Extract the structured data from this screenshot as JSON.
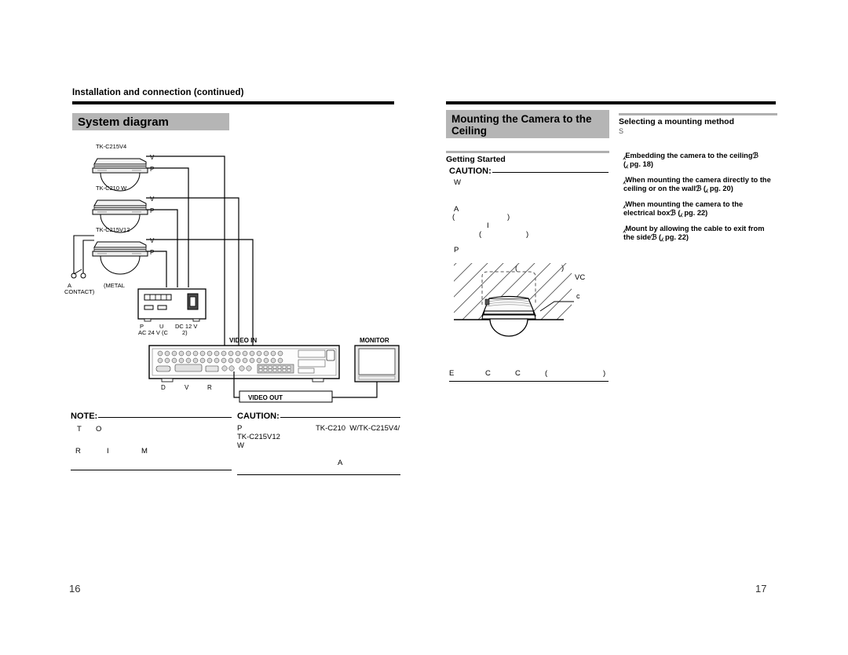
{
  "document": {
    "running_head": "Installation and connection (continued)",
    "left_page_number": "16",
    "right_page_number": "17"
  },
  "left_page": {
    "section_title": "System diagram",
    "diagram": {
      "camera_labels": [
        "TK-C215V4",
        "TK-C210  W",
        "TK-C215V12"
      ],
      "port_labels": [
        "V",
        "P"
      ],
      "contact_label_line1": "A",
      "contact_label_line2": "CONTACT)",
      "metal_label": "(METAL",
      "power_supply": {
        "line1_a": "P",
        "line1_b": "U",
        "line1_c": "DC 12 V",
        "line2_a": "AC 24 V (C",
        "line2_b": "2)"
      },
      "video_in_label": "VIDEO IN",
      "video_out_label": "VIDEO OUT",
      "monitor_label": "MONITOR",
      "dvr_caption": [
        "D",
        "V",
        "R"
      ]
    },
    "note_block": {
      "heading": "NOTE:",
      "frag_1": "T",
      "frag_2": "O",
      "frag_3": "R",
      "frag_4": "I",
      "frag_5": "M"
    },
    "caution_block": {
      "heading": "CAUTION:",
      "frag_1": "P",
      "frag_2": "TK-C210  W/TK-C215V4/",
      "frag_3": "TK-C215V12",
      "frag_4": "W",
      "frag_5": "A"
    }
  },
  "right_page": {
    "section_title_line1": "Mounting the Camera to the",
    "section_title_line2": "Ceiling",
    "getting_started": {
      "heading": "Getting Started",
      "caution_heading": "CAUTION:",
      "frag_1": "W",
      "frag_2": "A",
      "frag_3": "(",
      "frag_4": ")",
      "frag_5": "I",
      "frag_6": "(",
      "frag_7": ")",
      "frag_8": "P",
      "frag_9": "(",
      "frag_10": ")",
      "frag_11": "VC"
    },
    "ceiling_figure": {
      "callout": "c",
      "caption_1": "E",
      "caption_2": "C",
      "caption_3": "C",
      "caption_4": "(",
      "caption_5": ")"
    },
    "selecting_method": {
      "heading": "Selecting a mounting method",
      "sub_fragment": "S",
      "items": [
        {
          "text_line1": "⁁Embedding the camera to the ceilingℬ",
          "text_line2": "(⁁  pg. 18)"
        },
        {
          "text_line1": "⁁When mounting the camera directly to the",
          "text_line2": "ceiling or on the wallℬ (⁁   pg. 20)"
        },
        {
          "text_line1": "⁁When mounting the camera to the",
          "text_line2": "electrical boxℬ (⁁  pg. 22)"
        },
        {
          "text_line1": "⁁Mount by allowing the cable to exit from",
          "text_line2": "the sideℬ (⁁  pg. 22)"
        }
      ]
    }
  },
  "colors": {
    "band_gray": "#b5b5b5",
    "rule_black": "#000000",
    "subbar_gray": "#b0b0b0"
  }
}
